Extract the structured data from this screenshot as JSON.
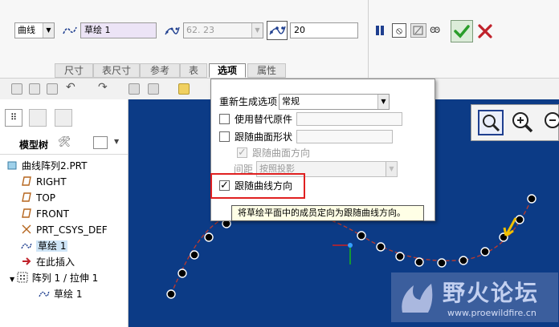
{
  "dashboard": {
    "type_value": "曲线",
    "sketch_value": "草绘 1",
    "spacing_value": "62. 23",
    "count_value": "20",
    "tabs": [
      "尺寸",
      "表尺寸",
      "参考",
      "表",
      "选项",
      "属性"
    ],
    "active_tab": "选项"
  },
  "options_menu": {
    "regen_label": "重新生成选项",
    "regen_value": "常规",
    "use_alt_label": "使用替代原件",
    "follow_surface_label": "跟随曲面形状",
    "follow_surface_dir_label": "跟随曲面方向",
    "spacing_label": "间距",
    "spacing_value": "按照投影",
    "follow_curve_label": "跟随曲线方向",
    "follow_curve_checked": true
  },
  "tooltip": "将草绘平面中的成员定向为跟随曲线方向。",
  "model_tree": {
    "header": "模型树",
    "items": [
      {
        "label": "曲线阵列2.PRT",
        "icon": "part-icon",
        "indent": 0
      },
      {
        "label": "RIGHT",
        "icon": "datum-plane-icon",
        "indent": 1
      },
      {
        "label": "TOP",
        "icon": "datum-plane-icon",
        "indent": 1
      },
      {
        "label": "FRONT",
        "icon": "datum-plane-icon",
        "indent": 1
      },
      {
        "label": "PRT_CSYS_DEF",
        "icon": "csys-icon",
        "indent": 1
      },
      {
        "label": "草绘 1",
        "icon": "sketch-icon",
        "indent": 1,
        "selected": true
      },
      {
        "label": "在此插入",
        "icon": "insert-arrow-icon",
        "indent": 1
      },
      {
        "label": "阵列 1 / 拉伸 1",
        "icon": "pattern-icon",
        "indent": 1
      },
      {
        "label": "草绘 1",
        "icon": "sketch-icon",
        "indent": 2
      }
    ]
  },
  "watermark": {
    "title": "野火论坛",
    "url": "www.proewildfire.cn"
  },
  "colors": {
    "canvas": "#0c3b86",
    "curve": "#c0392b",
    "highlight_box": "#e02020",
    "ok": "#2a9d2a",
    "cancel": "#c0222b",
    "pause": "#1f3f8f"
  }
}
